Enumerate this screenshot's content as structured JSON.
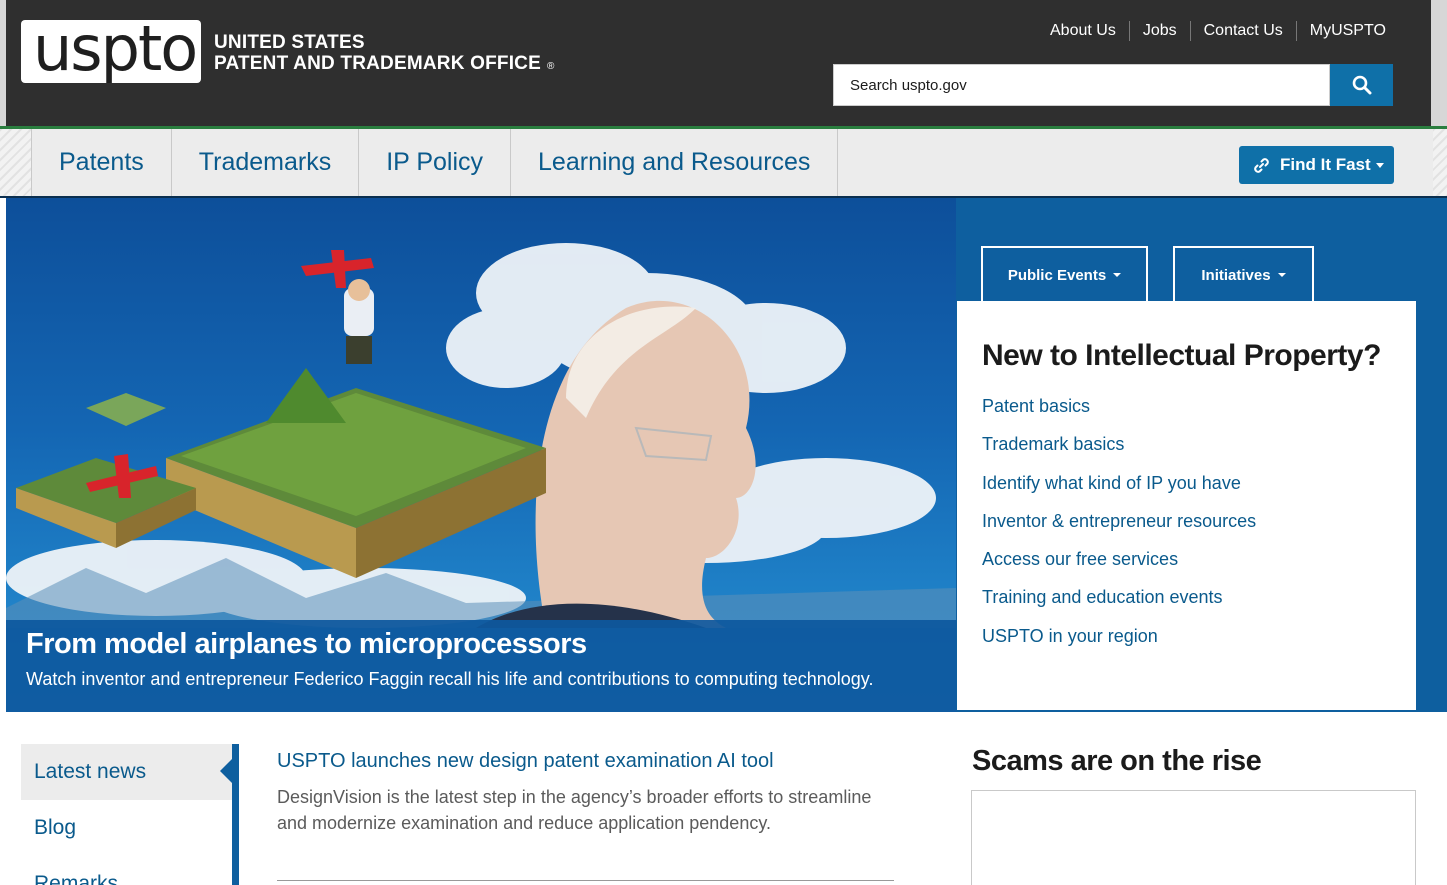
{
  "header": {
    "logo_text": "uspto",
    "agency_line1": "UNITED STATES",
    "agency_line2": "PATENT AND TRADEMARK OFFICE",
    "registered_mark": "®",
    "utility_nav": [
      "About Us",
      "Jobs",
      "Contact Us",
      "MyUSPTO"
    ],
    "search_placeholder": "Search uspto.gov",
    "search_icon": "magnifier-icon"
  },
  "main_nav": {
    "items": [
      "Patents",
      "Trademarks",
      "IP Policy",
      "Learning and Resources"
    ],
    "find_it_fast": "Find It Fast",
    "find_it_fast_icon": "link-icon"
  },
  "hero": {
    "title": "From model airplanes to microprocessors",
    "subtitle": "Watch inventor and entrepreneur Federico Faggin recall his life and contributions to computing technology."
  },
  "right_panel": {
    "tabs": [
      "Public Events",
      "Initiatives"
    ],
    "heading": "New to Intellectual Property?",
    "links": [
      "Patent basics",
      "Trademark basics",
      "Identify what kind of IP you have",
      "Inventor & entrepreneur resources",
      "Access our free services",
      "Training and education events",
      "USPTO in your region"
    ]
  },
  "news": {
    "tabs": [
      "Latest news",
      "Blog",
      "Remarks"
    ],
    "headline": "USPTO launches new design patent examination AI tool",
    "description": "DesignVision is the latest step in the agency’s broader efforts to streamline and modernize examination and reduce application pendency."
  },
  "scams": {
    "heading": "Scams are on the rise"
  },
  "colors": {
    "header_bg": "#2f2f2f",
    "link_blue": "#0a5a8c",
    "primary_blue": "#0f70a8",
    "panel_blue": "#0e5f9f",
    "nav_green": "#2a7e3f"
  }
}
